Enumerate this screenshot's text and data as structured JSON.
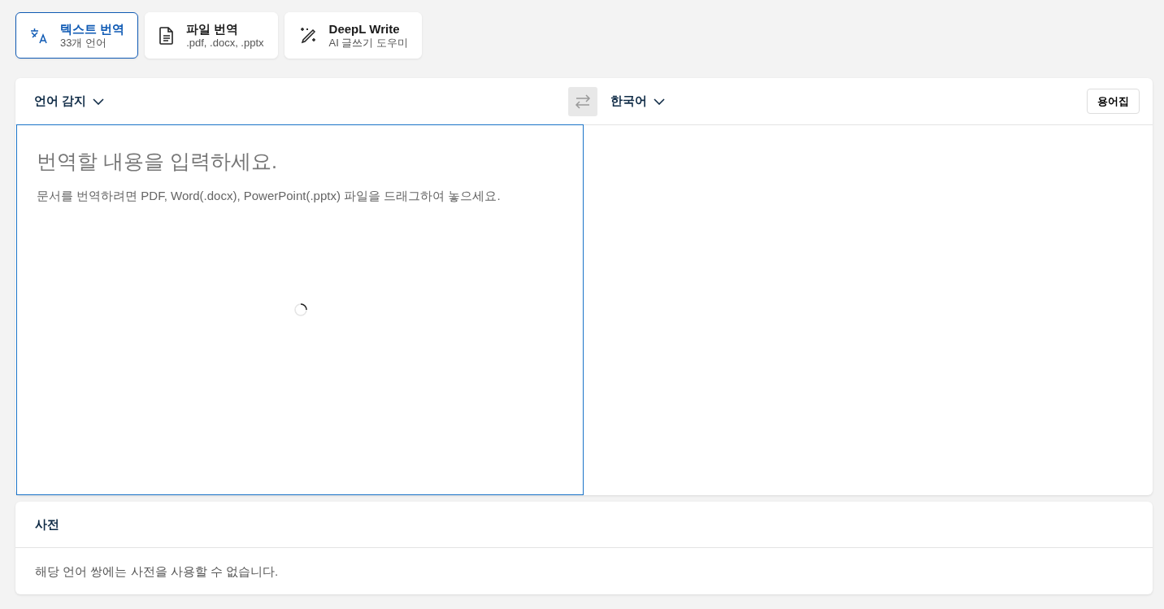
{
  "mode_tabs": [
    {
      "kind": "text",
      "title": "텍스트 번역",
      "subtitle": "33개 언어",
      "selected": true
    },
    {
      "kind": "file",
      "title": "파일 번역",
      "subtitle": ".pdf, .docx, .pptx",
      "selected": false
    },
    {
      "kind": "write",
      "title": "DeepL Write",
      "subtitle": "AI 글쓰기 도우미",
      "selected": false
    }
  ],
  "translator": {
    "source_language": "언어 감지",
    "swap_disabled": true,
    "target_language": "한국어",
    "glossary_button": "용어집",
    "source": {
      "placeholder": "번역할 내용을 입력하세요.",
      "hint": "문서를 번역하려면 PDF, Word(.docx), PowerPoint(.pptx) 파일을 드래그하여 놓으세요.",
      "loading": true
    }
  },
  "dictionary": {
    "title": "사전",
    "message": "해당 언어 쌍에는 사전을 사용할 수 없습니다."
  }
}
